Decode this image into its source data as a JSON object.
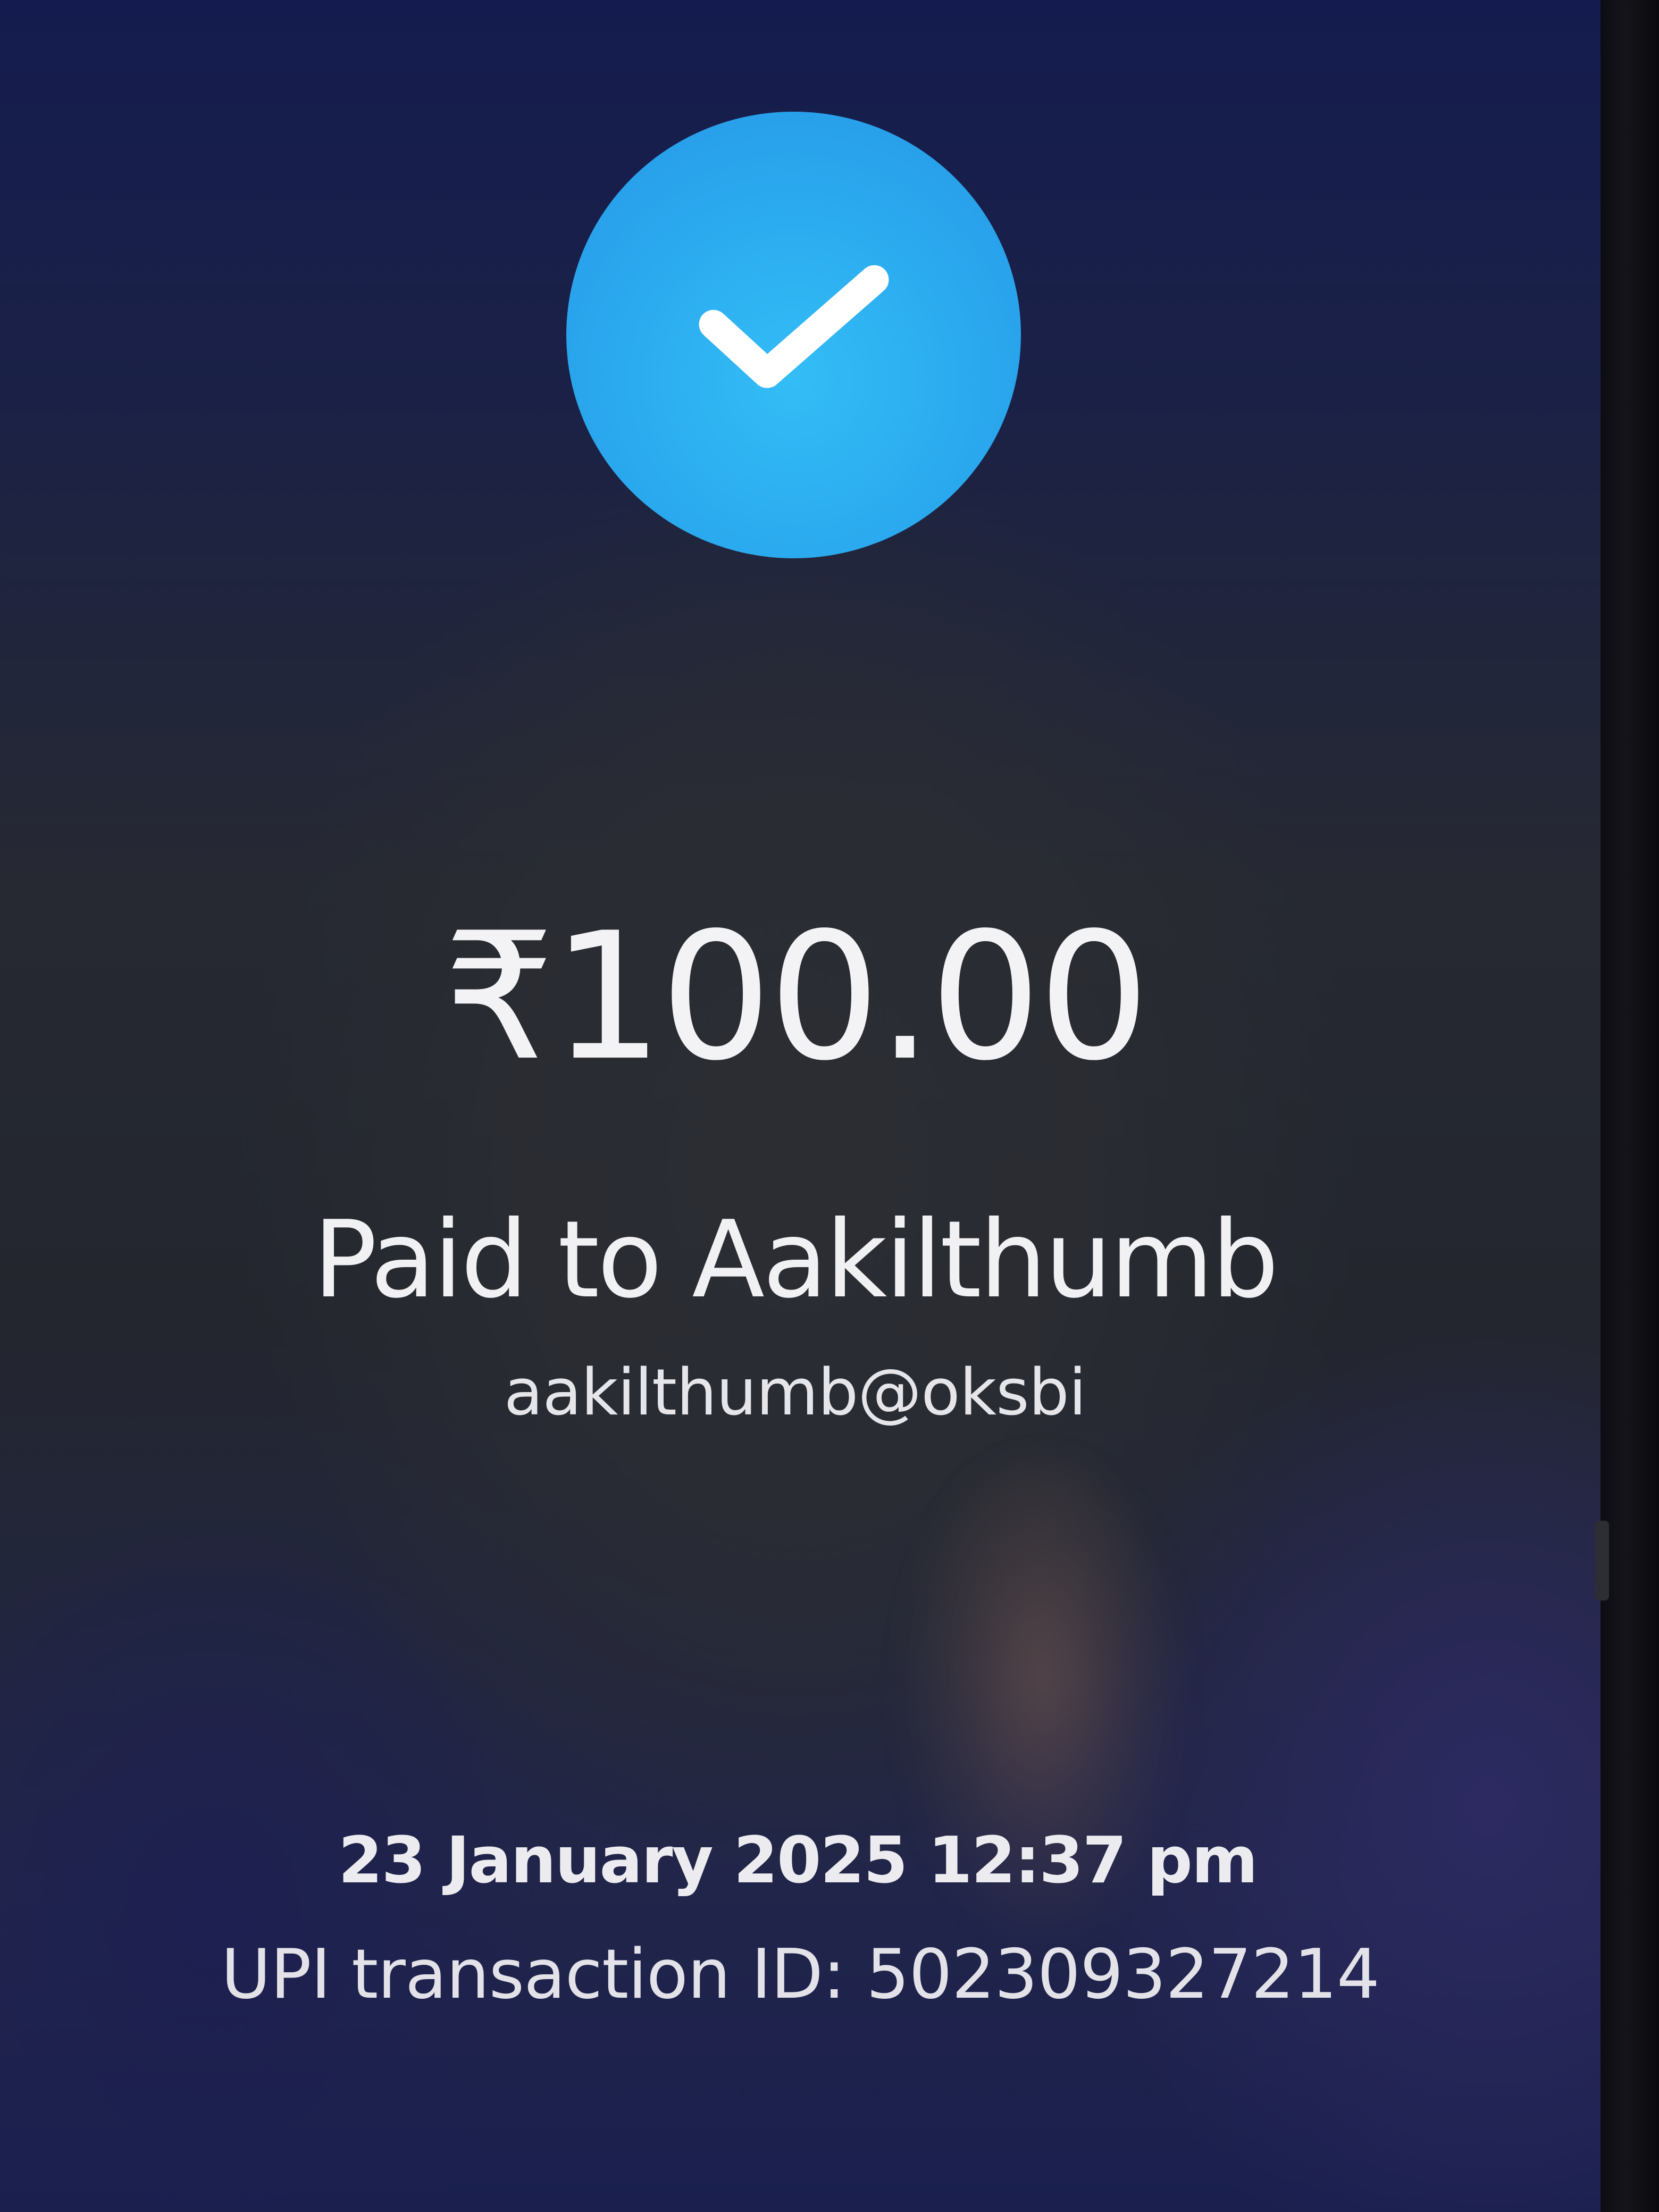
{
  "status": {
    "icon": "check-icon",
    "circle_color": "#2ba9ef"
  },
  "payment": {
    "amount": "₹100.00",
    "paid_to": "Paid to Aakilthumb",
    "upi_id": "aakilthumb@oksbi"
  },
  "transaction": {
    "datetime": "23 January 2025 12:37 pm",
    "upi_transaction_id": "UPI transaction ID: 502309327214"
  }
}
